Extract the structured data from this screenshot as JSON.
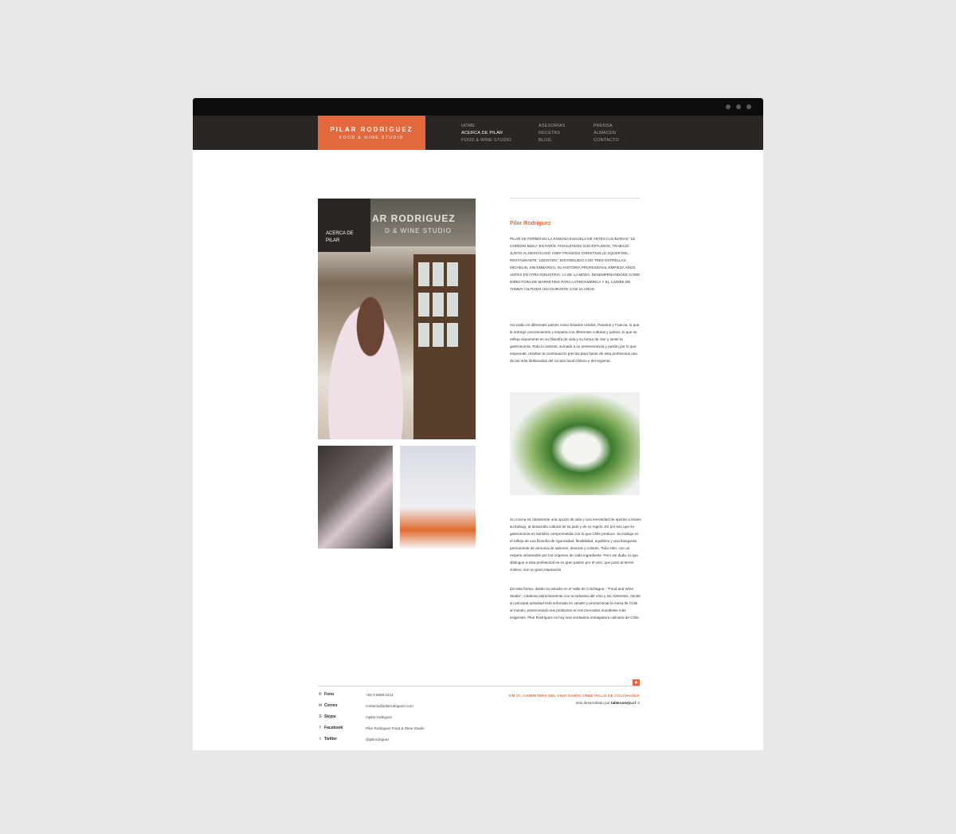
{
  "brand": {
    "name": "Pilar Rodriguez",
    "tagline": "FOOD & WINE STUDIO"
  },
  "nav": {
    "col1": [
      "HOME",
      "ACERCA DE PILAR",
      "FOOD & WINE STUDIO"
    ],
    "col2": [
      "ASESORIAS",
      "RECETAS",
      "BLOG"
    ],
    "col3": [
      "PRENSA",
      "ALMACEN",
      "CONTACTO"
    ],
    "active": "ACERCA DE PILAR"
  },
  "photo": {
    "about_label": "ACERCA DE PILAR",
    "sign_line1": "AR RODRIGUEZ",
    "sign_line2": "D & WINE STUDIO"
  },
  "content": {
    "title": "Pilar Rodriguez",
    "p1": "Pilar se formó en la famosa escuela de artes culinarias \"Le Cordon Bleu\" en París. Finalizados sus estudios, trabajó junto al destacado chef francés Christian Le Squer del restaurante \"Ledoyen\", distinguido con tres estrellas Michelín. Sin embargo, su historia profesional empieza años antes en otra industria: la de la moda, desempeñándose como directora de marketing para Latinoamérica y el Caribe de Tommy Hilfiger USA durante casi 10 años.",
    "p2": "Ha vivido en diferentes países como Estados Unidos, Panamá y Francia, lo que le entregó conocimientos y empatía con diferentes culturas y países, lo que se refleja claramente en su filosofía de vida y su forma de vivir y sentir la gastronomía. Todo lo anterior, sumado a su perseverancia y pasión por lo que emprende, resultan la combinación precisa para hacer de esta profesional una de las más destacadas del circuito local chileno y del regional.",
    "p3": "Su cocina es claramente una opción de vida y una necesidad de aportar a través su trabajo, al desarrollo cultural de su país y de su región. Es por eso que su gastronomía es también comprometida con lo que Chile produce. Su trabajo es el reflejo de una filosofía de rigurosidad, flexibilidad, equilibrio y una búsqueda permanente de armonía de sabores, texturas y colores. Todo esto, con un respeto intransable por los orígenes de cada ingrediente. Pero sin duda, lo que distingue a esta profesional es su gran pasión por el vino, que junto al terroir chileno, son su gran inspiración.",
    "p4": "De esta forma, desde su estudio en el Valle de Colchagua - \"Food and Wine Studio\", colabora estrechamente con la Industria del Vino y los Alimentos, donde su principal actividad está enfocada en vender y promocionar la mesa de Chile al mundo, posicionando sus productos en los mercados mundiales más exigentes. Pilar Rodríguez es hoy una verdadera embajadora culinaria de Chile."
  },
  "footer": {
    "contacts": [
      {
        "icon": "phone-icon",
        "glyph": "✆",
        "label": "Fono",
        "value": "+56 9 6899 0441"
      },
      {
        "icon": "mail-icon",
        "glyph": "✉",
        "label": "Correo",
        "value": "contacto@pilarrodriguez.com"
      },
      {
        "icon": "skype-icon",
        "glyph": "S",
        "label": "Skype",
        "value": "mpilar-rodriguez"
      },
      {
        "icon": "facebook-icon",
        "glyph": "f",
        "label": "Facebook",
        "value": "Pilar Rodriguez Food & Wine Studio"
      },
      {
        "icon": "twitter-icon",
        "glyph": "t",
        "label": "Twitter",
        "value": "@pilirodriguez"
      }
    ],
    "address": "KM 37, CARRETERA DEL VINO SANTA CRUZ VALLE DE COLCHAGUA",
    "credit_prefix": "sitio desarrollado por",
    "credit_link": "tallerconejo.cl",
    "credit_suffix": ":3",
    "up_glyph": "▲"
  },
  "colors": {
    "accent": "#e2683d",
    "dark": "#2a2624",
    "titlebar": "#0d0d0d"
  }
}
